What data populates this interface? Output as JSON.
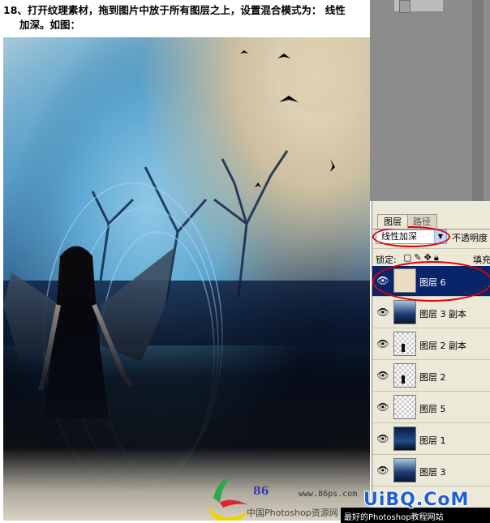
{
  "instruction": {
    "line1": "18、打开纹理素材，拖到图片中放于所有图层之上，设置混合模式为： 线性",
    "line2": "加深。如图："
  },
  "watermark": {
    "logo_number": "86",
    "logo_url": "www.86ps.com",
    "logo_caption": "中国Photoshop资源网",
    "site_mark": "UiBQ.CoM",
    "footer": "最好的Photoshop教程网站"
  },
  "layers_panel": {
    "tabs": [
      {
        "label": "图层",
        "active": true
      },
      {
        "label": "路径",
        "active": false
      }
    ],
    "blend_mode": "线性加深",
    "opacity_label": "不透明度",
    "lock_label": "锁定:",
    "fill_label": "填充",
    "layers": [
      {
        "name": "图层 6",
        "selected": true,
        "thumb": "texture"
      },
      {
        "name": "图层 3 副本",
        "selected": false,
        "thumb": "sky"
      },
      {
        "name": "图层 2 副本",
        "selected": false,
        "thumb": "figure"
      },
      {
        "name": "图层 2",
        "selected": false,
        "thumb": "figure"
      },
      {
        "name": "图层 5",
        "selected": false,
        "thumb": "transparent"
      },
      {
        "name": "图层 1",
        "selected": false,
        "thumb": "night"
      },
      {
        "name": "图层 3",
        "selected": false,
        "thumb": "sky"
      }
    ]
  },
  "colors": {
    "selection": "#0a246a",
    "highlight_ring": "#e00000",
    "panel_bg": "#ece9d8",
    "site_mark": "#1f5fd6"
  }
}
